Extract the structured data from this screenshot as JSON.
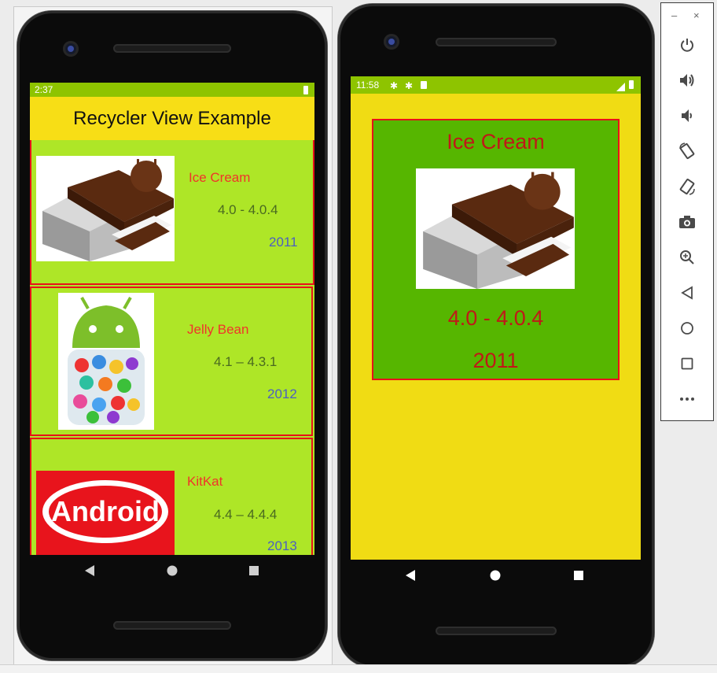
{
  "left_device": {
    "status": {
      "time": "2:37"
    },
    "app_title": "Recycler View Example",
    "cards": [
      {
        "title": "Ice Cream",
        "version": "4.0 - 4.0.4",
        "year": "2011",
        "image": "ice-cream-sandwich-image"
      },
      {
        "title": "Jelly Bean",
        "version": "4.1 – 4.3.1",
        "year": "2012",
        "image": "jelly-bean-image"
      },
      {
        "title": "KitKat",
        "version": "4.4 – 4.4.4",
        "year": "2013",
        "image": "kitkat-image",
        "logo_text": "Android"
      }
    ],
    "nav": [
      "back-icon",
      "home-icon",
      "recents-icon"
    ]
  },
  "right_device": {
    "status": {
      "time": "11:58"
    },
    "detail": {
      "title": "Ice Cream",
      "version": "4.0 - 4.0.4",
      "year": "2011",
      "image": "ice-cream-sandwich-image"
    },
    "nav": [
      "back-icon",
      "home-icon",
      "recents-icon"
    ]
  },
  "toolbar": {
    "window_controls": [
      "minimize-icon",
      "close-icon"
    ],
    "buttons": [
      "power-icon",
      "volume-up-icon",
      "volume-down-icon",
      "rotate-left-icon",
      "rotate-right-icon",
      "camera-icon",
      "zoom-icon",
      "back-icon",
      "home-icon",
      "overview-icon",
      "more-icon"
    ]
  },
  "colors": {
    "list_background": "#aee627",
    "card_border": "#e8111a",
    "title_bar": "#f7de16",
    "status_bar": "#8ec400",
    "detail_background": "#f0dc14",
    "detail_card": "#56b600",
    "detail_text": "#c01818"
  }
}
